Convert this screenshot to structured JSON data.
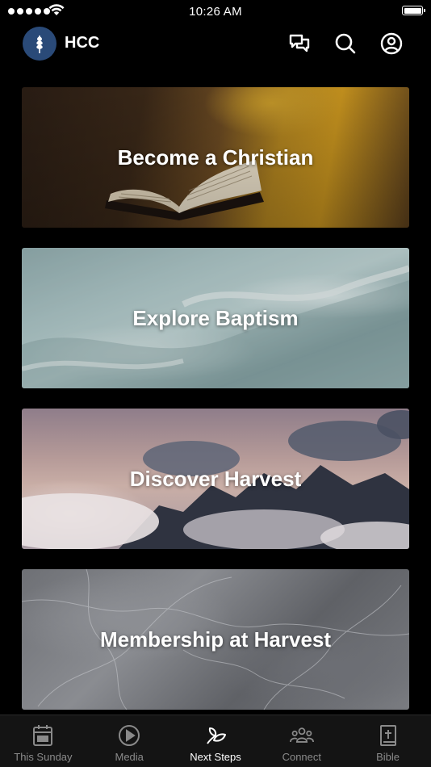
{
  "status_bar": {
    "time": "10:26 AM"
  },
  "header": {
    "brand": "HCC",
    "actions": [
      {
        "name": "chat-icon"
      },
      {
        "name": "search-icon"
      },
      {
        "name": "profile-icon"
      }
    ]
  },
  "cards": [
    {
      "label": "Become a Christian"
    },
    {
      "label": "Explore Baptism"
    },
    {
      "label": "Discover Harvest"
    },
    {
      "label": "Membership at Harvest"
    }
  ],
  "tabs": [
    {
      "label": "This Sunday",
      "icon": "calendar-icon",
      "active": false
    },
    {
      "label": "Media",
      "icon": "play-icon",
      "active": false
    },
    {
      "label": "Next Steps",
      "icon": "sprout-icon",
      "active": true
    },
    {
      "label": "Connect",
      "icon": "people-icon",
      "active": false
    },
    {
      "label": "Bible",
      "icon": "bible-icon",
      "active": false
    }
  ],
  "colors": {
    "background": "#000000",
    "tabbar": "#141414",
    "logo": "#2a4a78",
    "inactive_tab": "#8a8a8a",
    "active_tab": "#ffffff"
  }
}
